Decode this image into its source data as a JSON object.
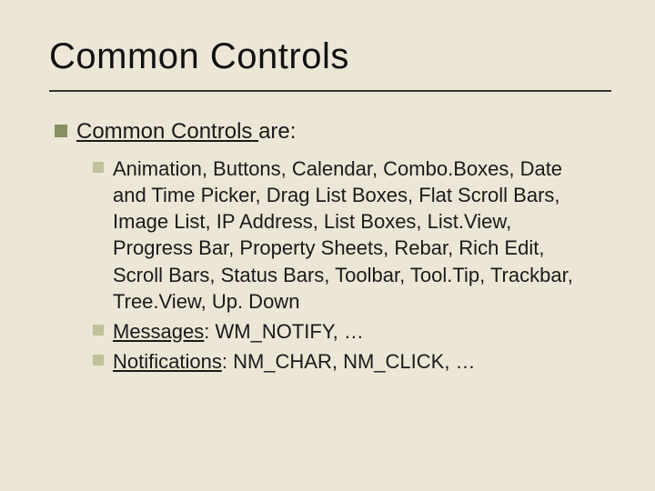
{
  "title": "Common Controls",
  "lvl1": {
    "underlined": "Common Controls ",
    "rest": "are:"
  },
  "items": [
    {
      "underlined": "",
      "rest": "Animation, Buttons, Calendar, Combo.Boxes, Date and Time Picker, Drag List Boxes, Flat Scroll Bars, Image List, IP Address, List Boxes, List.View, Progress Bar, Property Sheets, Rebar, Rich Edit, Scroll Bars, Status Bars, Toolbar, Tool.Tip, Trackbar, Tree.View, Up. Down"
    },
    {
      "underlined": "Messages",
      "rest": ": WM_NOTIFY, …"
    },
    {
      "underlined": "Notifications",
      "rest": ": NM_CHAR, NM_CLICK, …"
    }
  ]
}
